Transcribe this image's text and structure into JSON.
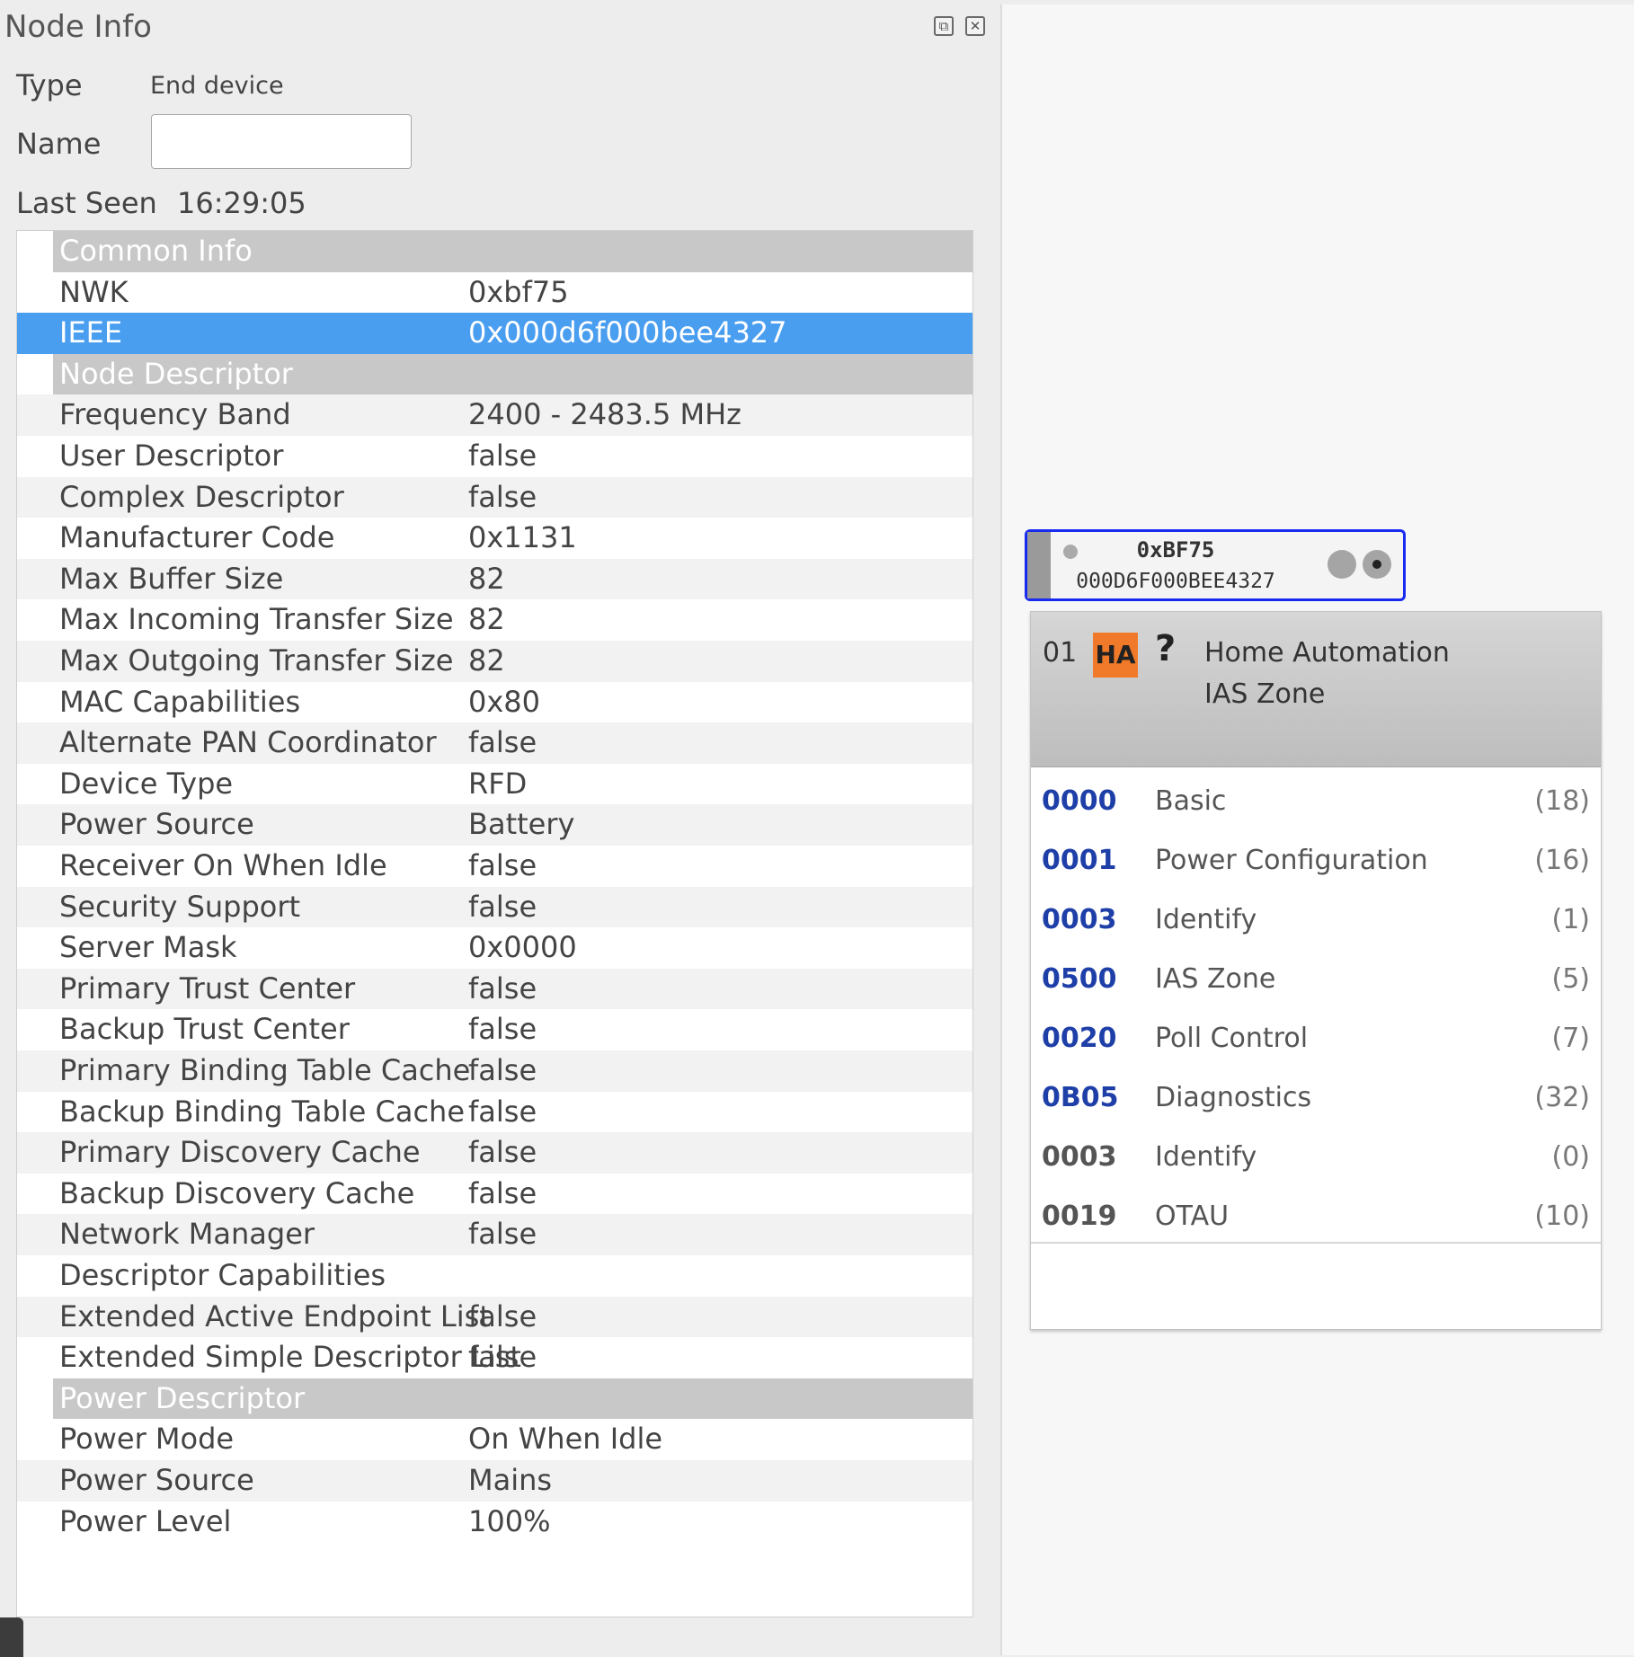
{
  "panel": {
    "title": "Node Info",
    "type_label": "Type",
    "type_value": "End device",
    "name_label": "Name",
    "name_value": "",
    "last_seen_label": "Last Seen",
    "last_seen_value": "16:29:05"
  },
  "tree_rows": [
    {
      "kind": "section",
      "key": "Common Info",
      "value": ""
    },
    {
      "kind": "row",
      "key": "NWK",
      "value": "0xbf75"
    },
    {
      "kind": "selected",
      "key": "IEEE",
      "value": "0x000d6f000bee4327"
    },
    {
      "kind": "section",
      "key": "Node Descriptor",
      "value": ""
    },
    {
      "kind": "row",
      "key": "Frequency Band",
      "value": "2400 - 2483.5 MHz"
    },
    {
      "kind": "row",
      "key": "User Descriptor",
      "value": "false"
    },
    {
      "kind": "row",
      "key": "Complex Descriptor",
      "value": "false"
    },
    {
      "kind": "row",
      "key": "Manufacturer Code",
      "value": "0x1131"
    },
    {
      "kind": "row",
      "key": "Max Buffer Size",
      "value": "82"
    },
    {
      "kind": "row",
      "key": "Max Incoming Transfer Size",
      "value": "82"
    },
    {
      "kind": "row",
      "key": "Max Outgoing Transfer Size",
      "value": "82"
    },
    {
      "kind": "row",
      "key": "MAC Capabilities",
      "value": "0x80"
    },
    {
      "kind": "row",
      "key": "Alternate PAN Coordinator",
      "value": "false"
    },
    {
      "kind": "row",
      "key": "Device Type",
      "value": "RFD"
    },
    {
      "kind": "row",
      "key": "Power Source",
      "value": "Battery"
    },
    {
      "kind": "row",
      "key": "Receiver On When Idle",
      "value": "false"
    },
    {
      "kind": "row",
      "key": "Security Support",
      "value": "false"
    },
    {
      "kind": "row",
      "key": "Server Mask",
      "value": "0x0000"
    },
    {
      "kind": "row",
      "key": "Primary Trust Center",
      "value": "false"
    },
    {
      "kind": "row",
      "key": "Backup Trust Center",
      "value": "false"
    },
    {
      "kind": "row",
      "key": "Primary Binding Table Cache",
      "value": "false"
    },
    {
      "kind": "row",
      "key": "Backup Binding Table Cache",
      "value": "false"
    },
    {
      "kind": "row",
      "key": "Primary Discovery Cache",
      "value": "false"
    },
    {
      "kind": "row",
      "key": "Backup Discovery Cache",
      "value": "false"
    },
    {
      "kind": "row",
      "key": "Network Manager",
      "value": "false"
    },
    {
      "kind": "row",
      "key": "Descriptor Capabilities",
      "value": ""
    },
    {
      "kind": "row",
      "key": "Extended Active Endpoint List",
      "value": "false"
    },
    {
      "kind": "row",
      "key": "Extended Simple Descriptor List",
      "value": "false"
    },
    {
      "kind": "section",
      "key": "Power Descriptor",
      "value": ""
    },
    {
      "kind": "row",
      "key": "Power Mode",
      "value": "On When Idle"
    },
    {
      "kind": "row",
      "key": "Power Source",
      "value": "Mains"
    },
    {
      "kind": "row",
      "key": "Power Level",
      "value": "100%"
    }
  ],
  "node": {
    "nwk": "0xBF75",
    "ieee": "000D6F000BEE4327"
  },
  "endpoint": {
    "id": "01",
    "badge": "HA",
    "badge_color": "#f07a2a",
    "unknown_device_mark": "?",
    "profile": "Home Automation",
    "device": "IAS Zone",
    "clusters": [
      {
        "id": "0000",
        "name": "Basic",
        "count": "(18)",
        "side": "server"
      },
      {
        "id": "0001",
        "name": "Power Configuration",
        "count": "(16)",
        "side": "server"
      },
      {
        "id": "0003",
        "name": "Identify",
        "count": "(1)",
        "side": "server"
      },
      {
        "id": "0500",
        "name": "IAS Zone",
        "count": "(5)",
        "side": "server"
      },
      {
        "id": "0020",
        "name": "Poll Control",
        "count": "(7)",
        "side": "server"
      },
      {
        "id": "0B05",
        "name": "Diagnostics",
        "count": "(32)",
        "side": "server"
      },
      {
        "id": "0003",
        "name": "Identify",
        "count": "(0)",
        "side": "client"
      },
      {
        "id": "0019",
        "name": "OTAU",
        "count": "(10)",
        "side": "client"
      }
    ],
    "server_color": "#1f3fa8",
    "client_color": "#555555"
  },
  "colors": {
    "selection": "#4a9ef0",
    "section_header": "#c8c8c8",
    "node_border": "#1a2bf0"
  },
  "icons": {
    "float": "float-icon",
    "close": "close-icon"
  }
}
